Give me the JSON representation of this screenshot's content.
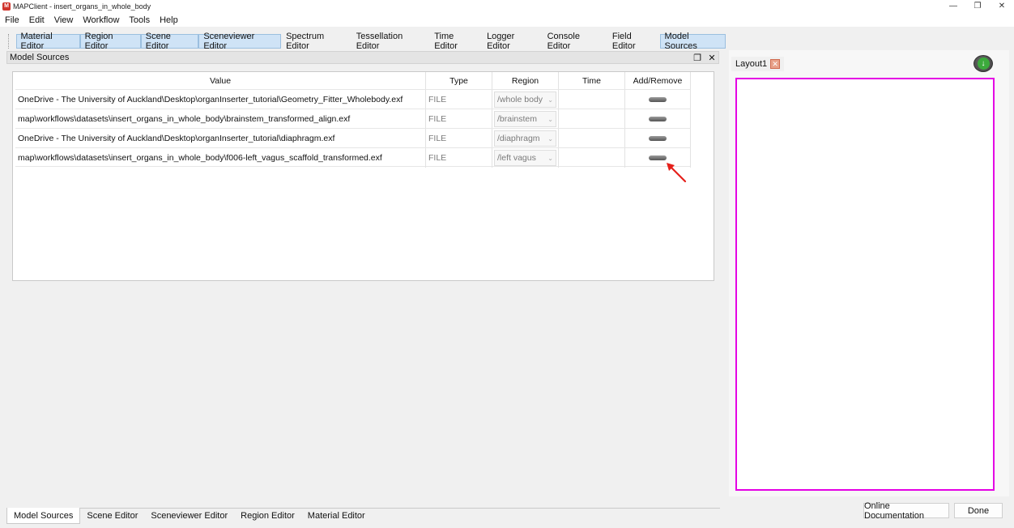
{
  "window": {
    "title": "MAPClient - insert_organs_in_whole_body",
    "icon": "map-client-app-icon",
    "controls": [
      "minimize",
      "restore",
      "close"
    ]
  },
  "menubar": {
    "items": [
      "File",
      "Edit",
      "View",
      "Workflow",
      "Tools",
      "Help"
    ]
  },
  "toolbar": {
    "tabs": [
      {
        "label": "Material Editor",
        "active": true
      },
      {
        "label": "Region Editor",
        "active": true
      },
      {
        "label": "Scene Editor",
        "active": true
      },
      {
        "label": "Sceneviewer Editor",
        "active": true
      },
      {
        "label": "Spectrum Editor",
        "active": false
      },
      {
        "label": "Tessellation Editor",
        "active": false
      },
      {
        "label": "Time Editor",
        "active": false
      },
      {
        "label": "Logger Editor",
        "active": false
      },
      {
        "label": "Console Editor",
        "active": false
      },
      {
        "label": "Field Editor",
        "active": false
      },
      {
        "label": "Model Sources",
        "active": true
      }
    ]
  },
  "dock": {
    "title": "Model Sources"
  },
  "table": {
    "headers": {
      "value": "Value",
      "type": "Type",
      "region": "Region",
      "time": "Time",
      "add_remove": "Add/Remove"
    },
    "rows": [
      {
        "value": "OneDrive - The University of Auckland\\Desktop\\organInserter_tutorial\\Geometry_Fitter_Wholebody.exf",
        "type": "FILE",
        "region": "/whole body",
        "time": ""
      },
      {
        "value": "map\\workflows\\datasets\\insert_organs_in_whole_body\\brainstem_transformed_align.exf",
        "type": "FILE",
        "region": "/brainstem",
        "time": ""
      },
      {
        "value": "OneDrive - The University of Auckland\\Desktop\\organInserter_tutorial\\diaphragm.exf",
        "type": "FILE",
        "region": "/diaphragm",
        "time": ""
      },
      {
        "value": "map\\workflows\\datasets\\insert_organs_in_whole_body\\f006-left_vagus_scaffold_transformed.exf",
        "type": "FILE",
        "region": "/left vagus",
        "time": ""
      }
    ]
  },
  "annotation": {
    "color": "#e5201b"
  },
  "right_panel": {
    "layout_tab_label": "Layout1",
    "layout_border_color": "#e400e4"
  },
  "bottom_tabs": [
    {
      "label": "Model Sources",
      "active": true
    },
    {
      "label": "Scene Editor",
      "active": false
    },
    {
      "label": "Sceneviewer Editor",
      "active": false
    },
    {
      "label": "Region Editor",
      "active": false
    },
    {
      "label": "Material Editor",
      "active": false
    }
  ],
  "buttons": {
    "online_documentation": "Online Documentation",
    "done": "Done"
  }
}
